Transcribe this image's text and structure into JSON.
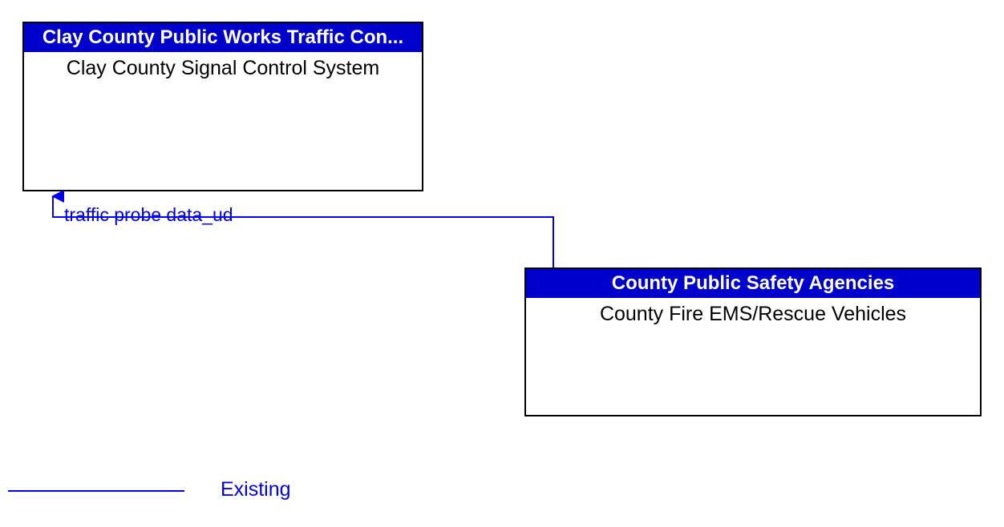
{
  "nodes": {
    "left": {
      "header": "Clay County Public Works Traffic Con...",
      "body": "Clay County Signal Control System"
    },
    "right": {
      "header": "County Public Safety Agencies",
      "body": "County Fire EMS/Rescue Vehicles"
    }
  },
  "flow": {
    "label": "traffic probe data_ud"
  },
  "legend": {
    "label": "Existing"
  }
}
